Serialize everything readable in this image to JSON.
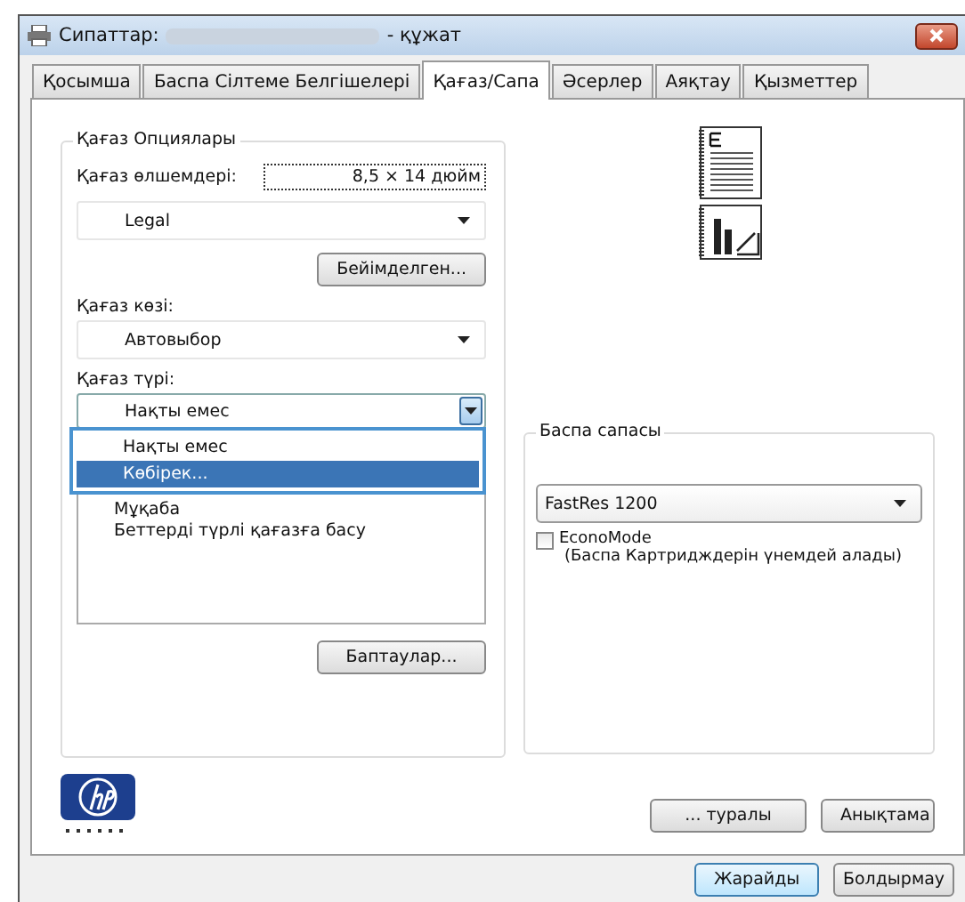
{
  "window": {
    "title": "Сипаттар:",
    "title_suffix": "- құжат"
  },
  "tabs": [
    {
      "label": "Қосымша",
      "selected": false
    },
    {
      "label": "Баспа Сілтеме Белгішелері",
      "selected": false
    },
    {
      "label": "Қағаз/Сапа",
      "selected": true
    },
    {
      "label": "Әсерлер",
      "selected": false
    },
    {
      "label": "Аяқтау",
      "selected": false
    },
    {
      "label": "Қызметтер",
      "selected": false
    }
  ],
  "paper_options": {
    "title": "Қағаз Опциялары",
    "size_label": "Қағаз өлшемдері:",
    "size_value": "8,5 × 14 дюйм",
    "size_select": "Legal",
    "custom_button": "Бейімделген...",
    "source_label": "Қағаз көзі:",
    "source_select": "Автовыбор",
    "type_label": "Қағаз түрі:",
    "type_select": "Нақты емес",
    "type_options": [
      {
        "label": "Нақты емес",
        "selected": false
      },
      {
        "label": "Көбірек...",
        "selected": true
      }
    ],
    "special_pages": [
      {
        "label": "Мұқаба"
      },
      {
        "label": "Беттерді түрлі қағазға басу"
      }
    ],
    "settings_button": "Баптаулар..."
  },
  "print_quality": {
    "title": "Баспа сапасы",
    "select": "FastRes 1200",
    "economode": {
      "label": "EconoMode",
      "note": "(Баспа Картридждерін үнемдей алады)",
      "checked": false
    }
  },
  "buttons": {
    "about": "... туралы",
    "help": "Анықтама",
    "ok": "Жарайды",
    "cancel": "Болдырмау"
  }
}
